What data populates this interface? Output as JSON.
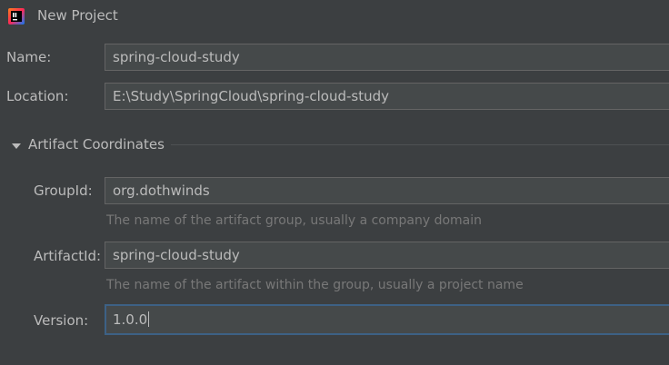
{
  "window": {
    "title": "New Project"
  },
  "project": {
    "name_label": "Name:",
    "name_value": "spring-cloud-study",
    "location_label": "Location:",
    "location_value": "E:\\Study\\SpringCloud\\spring-cloud-study"
  },
  "artifact": {
    "section_title": "Artifact Coordinates",
    "group_id_label": "GroupId:",
    "group_id_value": "org.dothwinds",
    "group_id_hint": "The name of the artifact group, usually a company domain",
    "artifact_id_label": "ArtifactId:",
    "artifact_id_value": "spring-cloud-study",
    "artifact_id_hint": "The name of the artifact within the group, usually a project name",
    "version_label": "Version:",
    "version_value": "1.0.0"
  },
  "icons": {
    "app": "intellij-idea-icon",
    "section_toggle": "triangle-down-icon"
  },
  "colors": {
    "background": "#3c3f41",
    "field_background": "#45494a",
    "focus_border": "#3d6185",
    "hint_text": "#787878"
  }
}
